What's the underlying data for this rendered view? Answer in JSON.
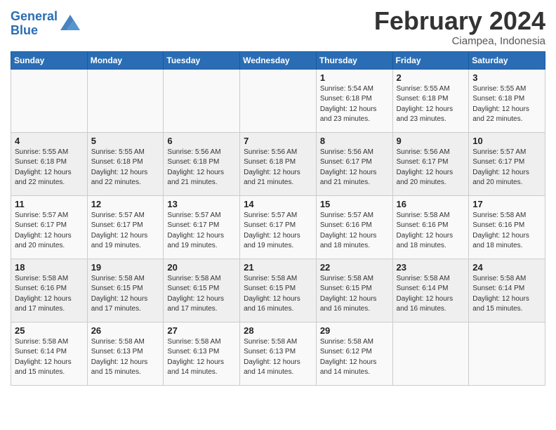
{
  "header": {
    "logo_line1": "General",
    "logo_line2": "Blue",
    "month_year": "February 2024",
    "location": "Ciampea, Indonesia"
  },
  "weekdays": [
    "Sunday",
    "Monday",
    "Tuesday",
    "Wednesday",
    "Thursday",
    "Friday",
    "Saturday"
  ],
  "weeks": [
    [
      {
        "day": "",
        "info": ""
      },
      {
        "day": "",
        "info": ""
      },
      {
        "day": "",
        "info": ""
      },
      {
        "day": "",
        "info": ""
      },
      {
        "day": "1",
        "info": "Sunrise: 5:54 AM\nSunset: 6:18 PM\nDaylight: 12 hours\nand 23 minutes."
      },
      {
        "day": "2",
        "info": "Sunrise: 5:55 AM\nSunset: 6:18 PM\nDaylight: 12 hours\nand 23 minutes."
      },
      {
        "day": "3",
        "info": "Sunrise: 5:55 AM\nSunset: 6:18 PM\nDaylight: 12 hours\nand 22 minutes."
      }
    ],
    [
      {
        "day": "4",
        "info": "Sunrise: 5:55 AM\nSunset: 6:18 PM\nDaylight: 12 hours\nand 22 minutes."
      },
      {
        "day": "5",
        "info": "Sunrise: 5:55 AM\nSunset: 6:18 PM\nDaylight: 12 hours\nand 22 minutes."
      },
      {
        "day": "6",
        "info": "Sunrise: 5:56 AM\nSunset: 6:18 PM\nDaylight: 12 hours\nand 21 minutes."
      },
      {
        "day": "7",
        "info": "Sunrise: 5:56 AM\nSunset: 6:18 PM\nDaylight: 12 hours\nand 21 minutes."
      },
      {
        "day": "8",
        "info": "Sunrise: 5:56 AM\nSunset: 6:17 PM\nDaylight: 12 hours\nand 21 minutes."
      },
      {
        "day": "9",
        "info": "Sunrise: 5:56 AM\nSunset: 6:17 PM\nDaylight: 12 hours\nand 20 minutes."
      },
      {
        "day": "10",
        "info": "Sunrise: 5:57 AM\nSunset: 6:17 PM\nDaylight: 12 hours\nand 20 minutes."
      }
    ],
    [
      {
        "day": "11",
        "info": "Sunrise: 5:57 AM\nSunset: 6:17 PM\nDaylight: 12 hours\nand 20 minutes."
      },
      {
        "day": "12",
        "info": "Sunrise: 5:57 AM\nSunset: 6:17 PM\nDaylight: 12 hours\nand 19 minutes."
      },
      {
        "day": "13",
        "info": "Sunrise: 5:57 AM\nSunset: 6:17 PM\nDaylight: 12 hours\nand 19 minutes."
      },
      {
        "day": "14",
        "info": "Sunrise: 5:57 AM\nSunset: 6:17 PM\nDaylight: 12 hours\nand 19 minutes."
      },
      {
        "day": "15",
        "info": "Sunrise: 5:57 AM\nSunset: 6:16 PM\nDaylight: 12 hours\nand 18 minutes."
      },
      {
        "day": "16",
        "info": "Sunrise: 5:58 AM\nSunset: 6:16 PM\nDaylight: 12 hours\nand 18 minutes."
      },
      {
        "day": "17",
        "info": "Sunrise: 5:58 AM\nSunset: 6:16 PM\nDaylight: 12 hours\nand 18 minutes."
      }
    ],
    [
      {
        "day": "18",
        "info": "Sunrise: 5:58 AM\nSunset: 6:16 PM\nDaylight: 12 hours\nand 17 minutes."
      },
      {
        "day": "19",
        "info": "Sunrise: 5:58 AM\nSunset: 6:15 PM\nDaylight: 12 hours\nand 17 minutes."
      },
      {
        "day": "20",
        "info": "Sunrise: 5:58 AM\nSunset: 6:15 PM\nDaylight: 12 hours\nand 17 minutes."
      },
      {
        "day": "21",
        "info": "Sunrise: 5:58 AM\nSunset: 6:15 PM\nDaylight: 12 hours\nand 16 minutes."
      },
      {
        "day": "22",
        "info": "Sunrise: 5:58 AM\nSunset: 6:15 PM\nDaylight: 12 hours\nand 16 minutes."
      },
      {
        "day": "23",
        "info": "Sunrise: 5:58 AM\nSunset: 6:14 PM\nDaylight: 12 hours\nand 16 minutes."
      },
      {
        "day": "24",
        "info": "Sunrise: 5:58 AM\nSunset: 6:14 PM\nDaylight: 12 hours\nand 15 minutes."
      }
    ],
    [
      {
        "day": "25",
        "info": "Sunrise: 5:58 AM\nSunset: 6:14 PM\nDaylight: 12 hours\nand 15 minutes."
      },
      {
        "day": "26",
        "info": "Sunrise: 5:58 AM\nSunset: 6:13 PM\nDaylight: 12 hours\nand 15 minutes."
      },
      {
        "day": "27",
        "info": "Sunrise: 5:58 AM\nSunset: 6:13 PM\nDaylight: 12 hours\nand 14 minutes."
      },
      {
        "day": "28",
        "info": "Sunrise: 5:58 AM\nSunset: 6:13 PM\nDaylight: 12 hours\nand 14 minutes."
      },
      {
        "day": "29",
        "info": "Sunrise: 5:58 AM\nSunset: 6:12 PM\nDaylight: 12 hours\nand 14 minutes."
      },
      {
        "day": "",
        "info": ""
      },
      {
        "day": "",
        "info": ""
      }
    ]
  ]
}
